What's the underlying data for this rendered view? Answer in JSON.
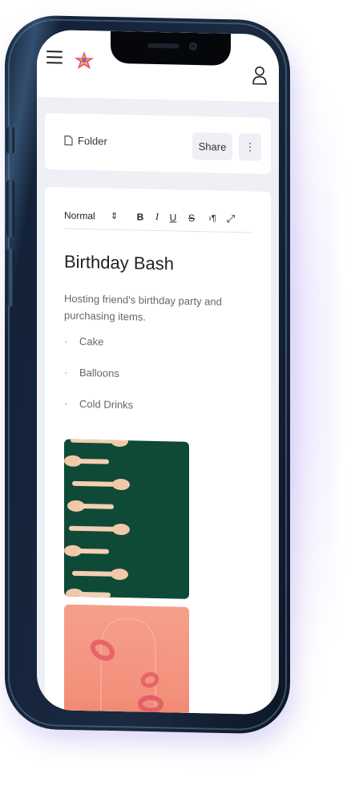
{
  "header": {
    "menu_icon": "hamburger-icon",
    "logo_icon": "rainbow-star-logo",
    "profile_icon": "user-icon"
  },
  "folder_bar": {
    "folder_icon": "document-icon",
    "folder_label": "Folder",
    "share_label": "Share",
    "more_icon": "vertical-dots-icon",
    "more_label": "⋮"
  },
  "toolbar": {
    "format_value": "Normal",
    "format_arrow": "⇕",
    "bold": "B",
    "italic": "I",
    "underline": "U",
    "strike": "S",
    "paragraph": "›¶",
    "expand": "⤢"
  },
  "note": {
    "title": "Birthday Bash",
    "description": "Hosting friend's birthday party and purchasing items.",
    "items": [
      "Cake",
      "Balloons",
      "Cold Drinks"
    ],
    "bullet": "·"
  },
  "colors": {
    "screen_bg": "#eff0f5",
    "card_bg": "#ffffff",
    "image1_bg": "#0f4a39",
    "image2_bg": "#f3907b"
  }
}
